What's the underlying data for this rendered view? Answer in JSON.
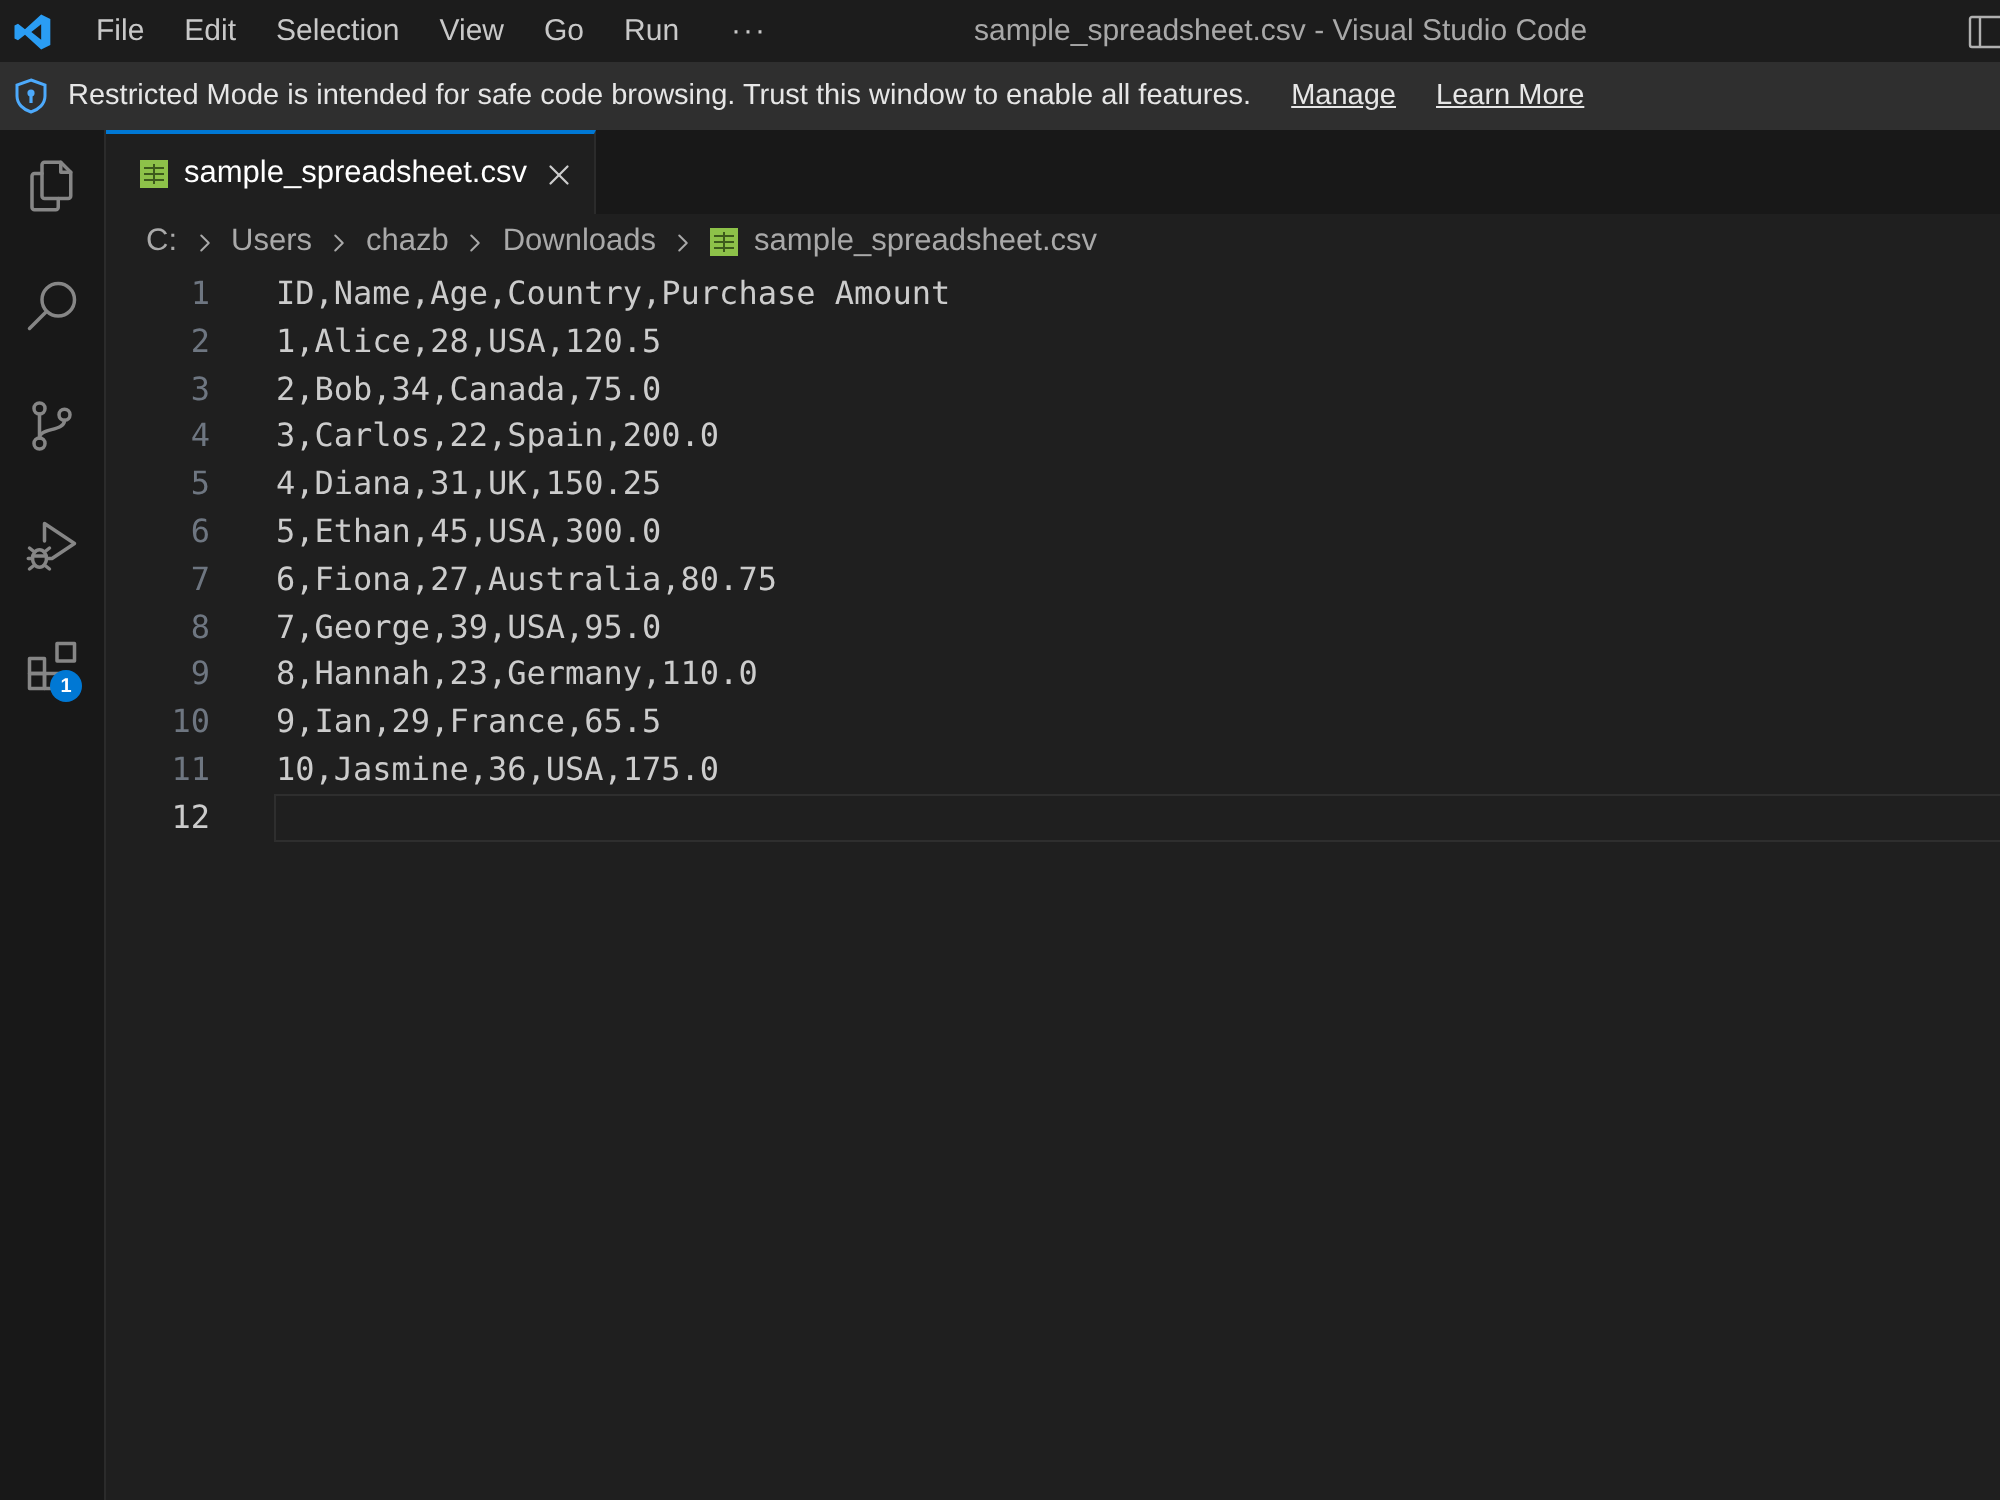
{
  "title_bar": {
    "menu": [
      "File",
      "Edit",
      "Selection",
      "View",
      "Go",
      "Run"
    ],
    "overflow": "···",
    "title": "sample_spreadsheet.csv - Visual Studio Code"
  },
  "banner": {
    "message": "Restricted Mode is intended for safe code browsing. Trust this window to enable all features.",
    "links": [
      "Manage",
      "Learn More"
    ]
  },
  "activity_bar": {
    "items": [
      {
        "kind": "explorer"
      },
      {
        "kind": "search"
      },
      {
        "kind": "source_control"
      },
      {
        "kind": "run_debug"
      },
      {
        "kind": "extensions",
        "badge": "1"
      }
    ]
  },
  "tabs": [
    {
      "label": "sample_spreadsheet.csv",
      "selected": true
    }
  ],
  "breadcrumb": [
    {
      "label": "C:",
      "kind": "folder"
    },
    {
      "label": "Users",
      "kind": "folder"
    },
    {
      "label": "chazb",
      "kind": "folder"
    },
    {
      "label": "Downloads",
      "kind": "folder"
    },
    {
      "label": "sample_spreadsheet.csv",
      "kind": "file"
    }
  ],
  "editor": {
    "lines": [
      {
        "number": "1",
        "text": "ID,Name,Age,Country,Purchase Amount",
        "active": false
      },
      {
        "number": "2",
        "text": "1,Alice,28,USA,120.5",
        "active": false
      },
      {
        "number": "3",
        "text": "2,Bob,34,Canada,75.0",
        "active": false
      },
      {
        "number": "4",
        "text": "3,Carlos,22,Spain,200.0",
        "active": false
      },
      {
        "number": "5",
        "text": "4,Diana,31,UK,150.25",
        "active": false
      },
      {
        "number": "6",
        "text": "5,Ethan,45,USA,300.0",
        "active": false
      },
      {
        "number": "7",
        "text": "6,Fiona,27,Australia,80.75",
        "active": false
      },
      {
        "number": "8",
        "text": "7,George,39,USA,95.0",
        "active": false
      },
      {
        "number": "9",
        "text": "8,Hannah,23,Germany,110.0",
        "active": false
      },
      {
        "number": "10",
        "text": "9,Ian,29,France,65.5",
        "active": false
      },
      {
        "number": "11",
        "text": "10,Jasmine,36,USA,175.0",
        "active": false
      },
      {
        "number": "12",
        "active": true
      }
    ]
  }
}
